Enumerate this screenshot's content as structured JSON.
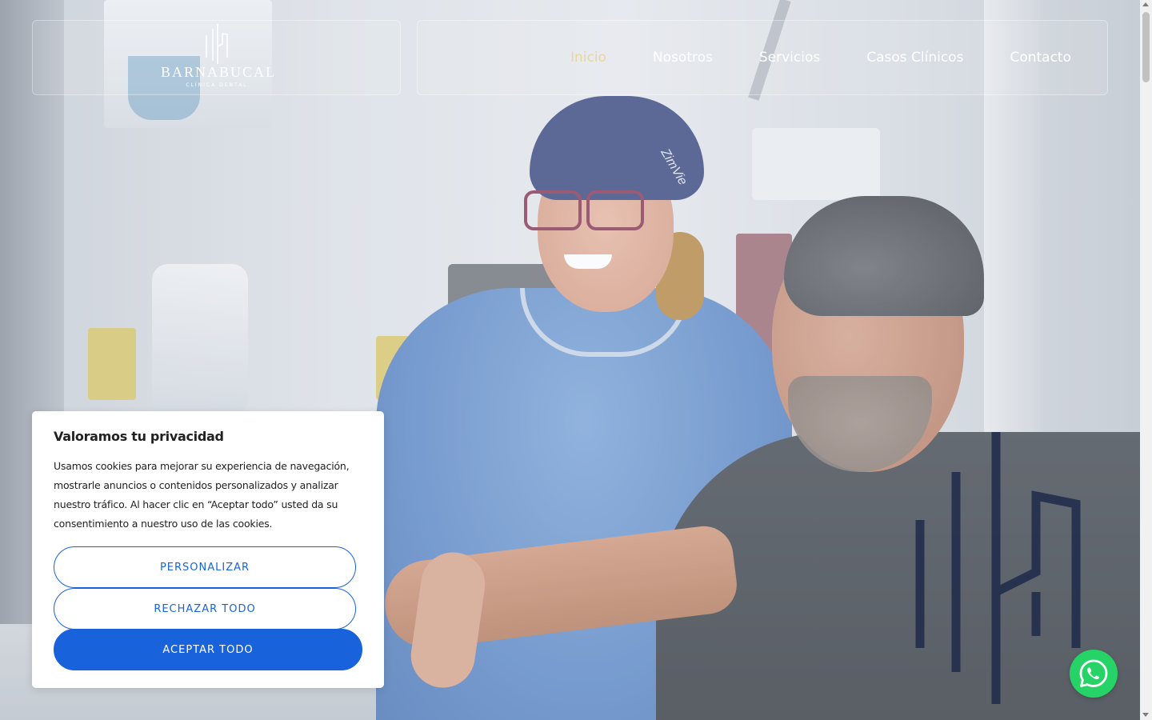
{
  "brand": {
    "name": "BARNABUCAL",
    "tagline": "CLÍNICA DENTAL"
  },
  "nav": {
    "items": [
      {
        "label": "Inicio",
        "active": true
      },
      {
        "label": "Nosotros",
        "active": false
      },
      {
        "label": "Servicios",
        "active": false
      },
      {
        "label": "Casos Clínicos",
        "active": false
      },
      {
        "label": "Contacto",
        "active": false
      }
    ]
  },
  "hero": {
    "cap_text": "ZimVie"
  },
  "cookie": {
    "title": "Valoramos tu privacidad",
    "body": "Usamos cookies para mejorar su experiencia de navegación, mostrarle anuncios o contenidos personalizados y analizar nuestro tráfico. Al hacer clic en “Aceptar todo” usted da su consentimiento a nuestro uso de las cookies.",
    "customize_label": "PERSONALIZAR",
    "reject_label": "RECHAZAR TODO",
    "accept_label": "ACEPTAR TODO"
  },
  "whatsapp": {
    "icon": "whatsapp-icon"
  },
  "colors": {
    "accent": "#1863dc",
    "nav_active": "#e9d59e",
    "whatsapp": "#25d366",
    "watermark": "#1d2a4a"
  }
}
